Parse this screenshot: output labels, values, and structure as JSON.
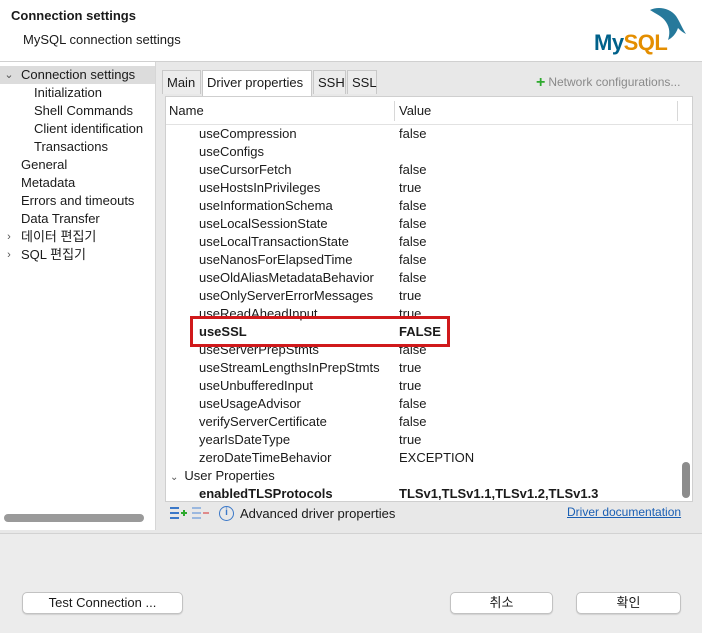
{
  "header": {
    "title": "Connection settings",
    "subtitle": "MySQL connection settings",
    "logo_text_my": "My",
    "logo_text_sql": "SQL"
  },
  "nav": {
    "items": [
      {
        "label": "Connection settings",
        "expanded": true,
        "selected": true
      },
      {
        "label": "Initialization"
      },
      {
        "label": "Shell Commands"
      },
      {
        "label": "Client identification"
      },
      {
        "label": "Transactions"
      },
      {
        "label": "General"
      },
      {
        "label": "Metadata"
      },
      {
        "label": "Errors and timeouts"
      },
      {
        "label": "Data Transfer"
      },
      {
        "label": "데이터 편집기",
        "expandable": true
      },
      {
        "label": "SQL 편집기",
        "expandable": true
      }
    ]
  },
  "tabs": [
    "Main",
    "Driver properties",
    "SSH",
    "SSL"
  ],
  "active_tab": "Driver properties",
  "network_configurations": "Network configurations...",
  "table": {
    "columns": [
      "Name",
      "Value"
    ],
    "rows": [
      {
        "name": "useCompression",
        "value": "false"
      },
      {
        "name": "useConfigs",
        "value": ""
      },
      {
        "name": "useCursorFetch",
        "value": "false"
      },
      {
        "name": "useHostsInPrivileges",
        "value": "true"
      },
      {
        "name": "useInformationSchema",
        "value": "false"
      },
      {
        "name": "useLocalSessionState",
        "value": "false"
      },
      {
        "name": "useLocalTransactionState",
        "value": "false"
      },
      {
        "name": "useNanosForElapsedTime",
        "value": "false"
      },
      {
        "name": "useOldAliasMetadataBehavior",
        "value": "false"
      },
      {
        "name": "useOnlyServerErrorMessages",
        "value": "true"
      },
      {
        "name": "useReadAheadInput",
        "value": "true"
      },
      {
        "name": "useSSL",
        "value": "FALSE",
        "bold": true
      },
      {
        "name": "useServerPrepStmts",
        "value": "false"
      },
      {
        "name": "useStreamLengthsInPrepStmts",
        "value": "true"
      },
      {
        "name": "useUnbufferedInput",
        "value": "true"
      },
      {
        "name": "useUsageAdvisor",
        "value": "false"
      },
      {
        "name": "verifyServerCertificate",
        "value": "false"
      },
      {
        "name": "yearIsDateType",
        "value": "true"
      },
      {
        "name": "zeroDateTimeBehavior",
        "value": "EXCEPTION"
      }
    ],
    "group": "User Properties",
    "group_rows": [
      {
        "name": "enabledTLSProtocols",
        "value": "TLSv1,TLSv1.1,TLSv1.2,TLSv1.3",
        "bold": true
      }
    ]
  },
  "bottom": {
    "advanced_label": "Advanced driver properties",
    "doc_link": "Driver documentation"
  },
  "footer": {
    "test_connection": "Test Connection ...",
    "cancel": "취소",
    "ok": "확인"
  },
  "colors": {
    "highlight": "#d0191b",
    "add_icon": "#2eaa2e",
    "link": "#1a5fb4",
    "mysql_blue": "#00618a",
    "mysql_orange": "#e48e00"
  }
}
